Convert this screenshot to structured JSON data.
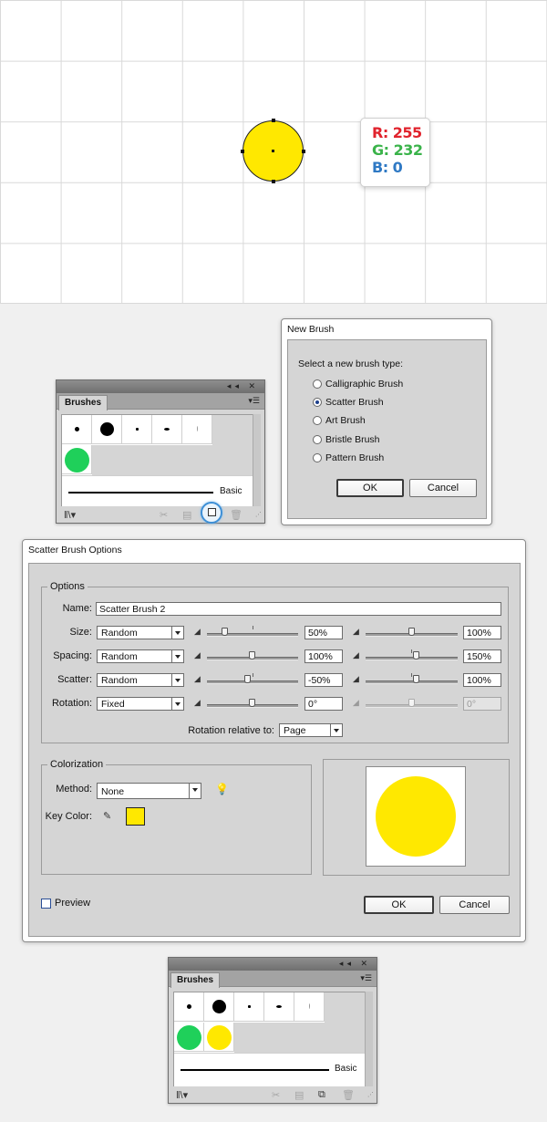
{
  "canvas": {
    "shape_fill": "#ffe800",
    "tooltip": {
      "r_label": "R: 255",
      "g_label": "G: 232",
      "b_label": "B: 0",
      "r_color": "#e1232d",
      "g_color": "#3ab34a",
      "b_color": "#2f79c4"
    }
  },
  "brushes_panel_top": {
    "tab_label": "Brushes",
    "basic_label": "Basic",
    "scatter_swatches": [
      "#1fd05a"
    ]
  },
  "new_brush_dialog": {
    "title": "New Brush",
    "prompt": "Select a new brush type:",
    "options": [
      "Calligraphic Brush",
      "Scatter Brush",
      "Art Brush",
      "Bristle Brush",
      "Pattern Brush"
    ],
    "selected": "Scatter Brush",
    "ok_label": "OK",
    "cancel_label": "Cancel"
  },
  "scatter_dialog": {
    "title": "Scatter Brush Options",
    "options_legend": "Options",
    "name_label": "Name:",
    "name_value": "Scatter Brush 2",
    "rows": [
      {
        "label": "Size:",
        "mode": "Random",
        "min_value": "50%",
        "max_value": "100%",
        "min_level": 0.2,
        "max_level": 0.5
      },
      {
        "label": "Spacing:",
        "mode": "Random",
        "min_value": "100%",
        "max_value": "150%",
        "min_level": 0.5,
        "max_level": 0.55
      },
      {
        "label": "Scatter:",
        "mode": "Random",
        "min_value": "-50%",
        "max_value": "100%",
        "min_level": 0.45,
        "max_level": 0.55
      },
      {
        "label": "Rotation:",
        "mode": "Fixed",
        "min_value": "0°",
        "max_value": "0°",
        "min_level": 0.5,
        "max_level": 0.5
      }
    ],
    "rotation_relative_label": "Rotation relative to:",
    "rotation_relative_value": "Page",
    "colorization_legend": "Colorization",
    "method_label": "Method:",
    "method_value": "None",
    "key_color_label": "Key Color:",
    "key_color": "#ffe800",
    "preview_label": "Preview",
    "ok_label": "OK",
    "cancel_label": "Cancel"
  },
  "brushes_panel_bottom": {
    "tab_label": "Brushes",
    "basic_label": "Basic",
    "scatter_swatches": [
      "#1fd05a",
      "#ffe800"
    ]
  }
}
